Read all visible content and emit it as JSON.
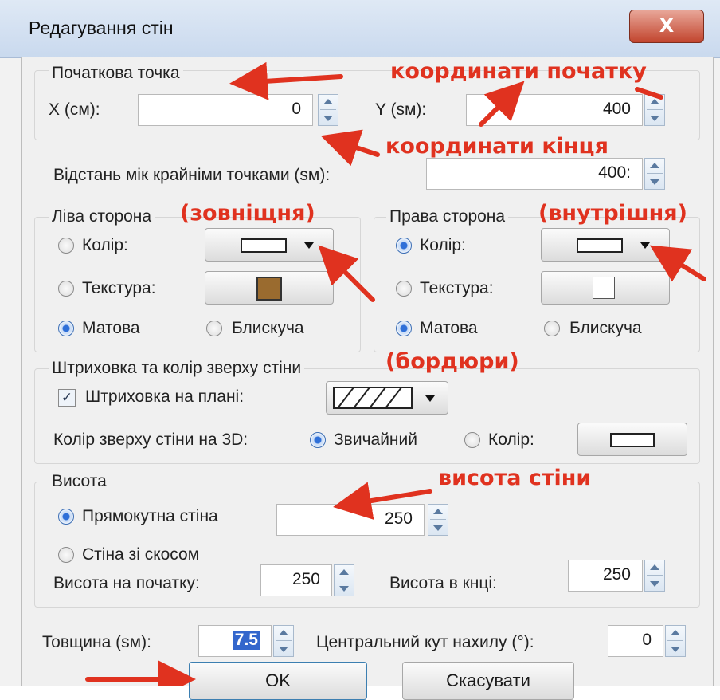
{
  "window": {
    "title": "Редагування стін",
    "close_label": "X"
  },
  "start_point": {
    "group_label": "Початкова точка",
    "x_label": "X (см):",
    "x_value": "0",
    "y_label": "Y (sм):",
    "y_value": "400"
  },
  "distance": {
    "label": "Відстань мік крайніми точками (sм):",
    "value": "400:"
  },
  "left_side": {
    "group_label": "Ліва сторона",
    "color_label": "Колір:",
    "texture_label": "Текстура:",
    "matte_label": "Матова",
    "glossy_label": "Блискуча",
    "color_selected": false,
    "matte_selected": true
  },
  "right_side": {
    "group_label": "Права сторона",
    "color_label": "Колір:",
    "texture_label": "Текстура:",
    "matte_label": "Матова",
    "glossy_label": "Блискуча",
    "color_selected": true,
    "matte_selected": true
  },
  "hatching": {
    "group_label": "Штриховка та колір зверху стіни",
    "hatch_label": "Штриховка на плані:",
    "hatch_checked": true,
    "top_color_label": "Колір зверху стіни на 3D:",
    "ordinary_label": "Звичайний",
    "color_label": "Колір:"
  },
  "height": {
    "group_label": "Висота",
    "rect_label": "Прямокутна стіна",
    "rect_value": "250",
    "slant_label": "Стіна зі скосом",
    "start_label": "Висота на початку:",
    "start_value": "250",
    "end_label": "Висота в кнці:",
    "end_value": "250"
  },
  "thickness": {
    "label": "Товщина (sм):",
    "value": "7.5"
  },
  "angle": {
    "label": "Центральний кут нахилу (°):",
    "value": "0"
  },
  "buttons": {
    "ok": "OK",
    "cancel": "Скасувати"
  },
  "annotations": {
    "start_coords": "координати початку",
    "end_coords": "координати кінця",
    "outer": "(зовніщня)",
    "inner": "(внутрішня)",
    "borders": "(бордюри)",
    "wall_height": "висота стіни"
  },
  "colors": {
    "annotation": "#e0321f",
    "texture_brown": "#9a6b2f"
  }
}
